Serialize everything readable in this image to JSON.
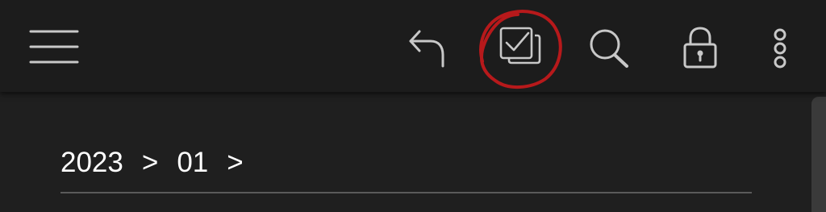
{
  "toolbar": {
    "icons": {
      "menu": "hamburger-menu-icon",
      "undo": "undo-arrow-icon",
      "select": "multi-select-checkbox-icon",
      "search": "search-icon",
      "lock": "lock-icon",
      "more": "more-vertical-icon"
    },
    "highlight_color": "#c0191b"
  },
  "breadcrumb": {
    "items": [
      "2023",
      "01"
    ],
    "separator": ">"
  },
  "colors": {
    "toolbar_bg": "#1c1c1c",
    "content_bg": "#1f1f1f",
    "icon": "#c8c8c8",
    "text": "#ffffff"
  }
}
